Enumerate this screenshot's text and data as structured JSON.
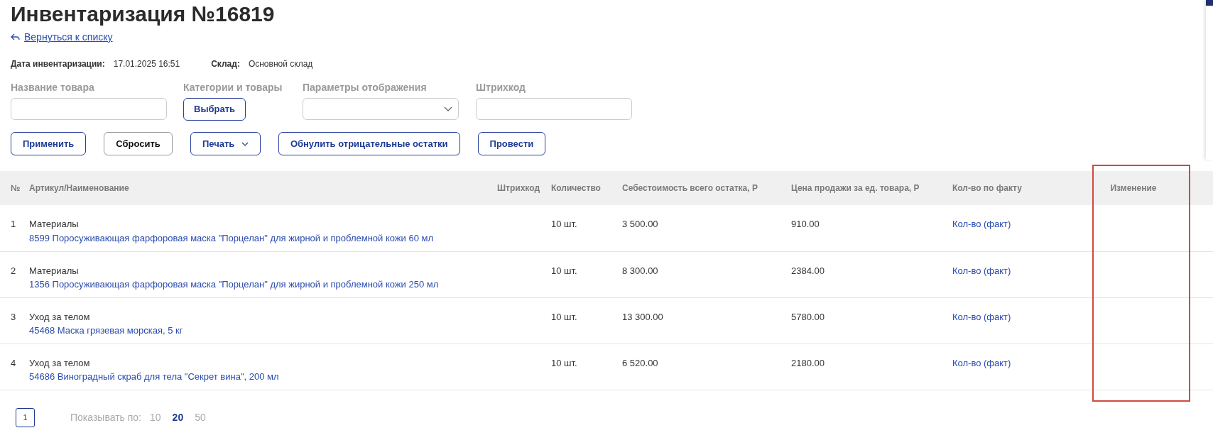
{
  "page": {
    "title": "Инвентаризация №16819",
    "back_link": "Вернуться к списку"
  },
  "info": [
    {
      "label": "Дата инвентаризации:",
      "value": "17.01.2025 16:51"
    },
    {
      "label": "Склад:",
      "value": "Основной склад"
    }
  ],
  "filters": [
    {
      "kind": "input",
      "label": "Название товара"
    },
    {
      "kind": "button",
      "label": "Категории и товары",
      "button": "Выбрать"
    },
    {
      "kind": "select",
      "label": "Параметры отображения"
    },
    {
      "kind": "input",
      "label": "Штрихкод"
    }
  ],
  "actions": [
    {
      "kind": "primary",
      "label": "Применить"
    },
    {
      "kind": "secondary",
      "label": "Сбросить"
    },
    {
      "kind": "dropdown",
      "label": "Печать"
    },
    {
      "kind": "primary",
      "label": "Обнулить отрицательные остатки"
    },
    {
      "kind": "primary",
      "label": "Провести"
    }
  ],
  "table": {
    "columns": [
      {
        "label": "№"
      },
      {
        "label": "Артикул/Наименование"
      },
      {
        "label": "Штрихкод"
      },
      {
        "label": "Количество"
      },
      {
        "label": "Себестоимость всего остатка, Р"
      },
      {
        "label": "Цена продажи за ед. товара, Р"
      },
      {
        "label": "Кол-во по факту"
      },
      {
        "label": "Изменение"
      }
    ],
    "rows": [
      {
        "number": "1",
        "category": "Материалы",
        "product": "8599 Поросуживающая фарфоровая маска \"Порцелан\" для жирной и проблемной кожи 60 мл",
        "quantity": "10 шт.",
        "cost": "3 500.00",
        "price": "910.00",
        "fact": "Кол-во (факт)"
      },
      {
        "number": "2",
        "category": "Материалы",
        "product": "1356 Поросуживающая фарфоровая маска \"Порцелан\" для жирной и проблемной кожи 250 мл",
        "quantity": "10 шт.",
        "cost": "8 300.00",
        "price": "2384.00",
        "fact": "Кол-во (факт)"
      },
      {
        "number": "3",
        "category": "Уход за телом",
        "product": "45468 Маска грязевая морская, 5 кг",
        "quantity": "10 шт.",
        "cost": "13 300.00",
        "price": "5780.00",
        "fact": "Кол-во (факт)"
      },
      {
        "number": "4",
        "category": "Уход за телом",
        "product": "54686 Виноградный скраб для тела \"Секрет вина\", 200 мл",
        "quantity": "10 шт.",
        "cost": "6 520.00",
        "price": "2180.00",
        "fact": "Кол-во (факт)"
      }
    ]
  },
  "pagination": {
    "pages": [
      {
        "label": "1",
        "selected": true
      }
    ],
    "page_size_label": "Показывать по:",
    "page_sizes": [
      {
        "label": "10",
        "selected": false
      },
      {
        "label": "20",
        "selected": true
      },
      {
        "label": "50",
        "selected": false
      }
    ]
  }
}
